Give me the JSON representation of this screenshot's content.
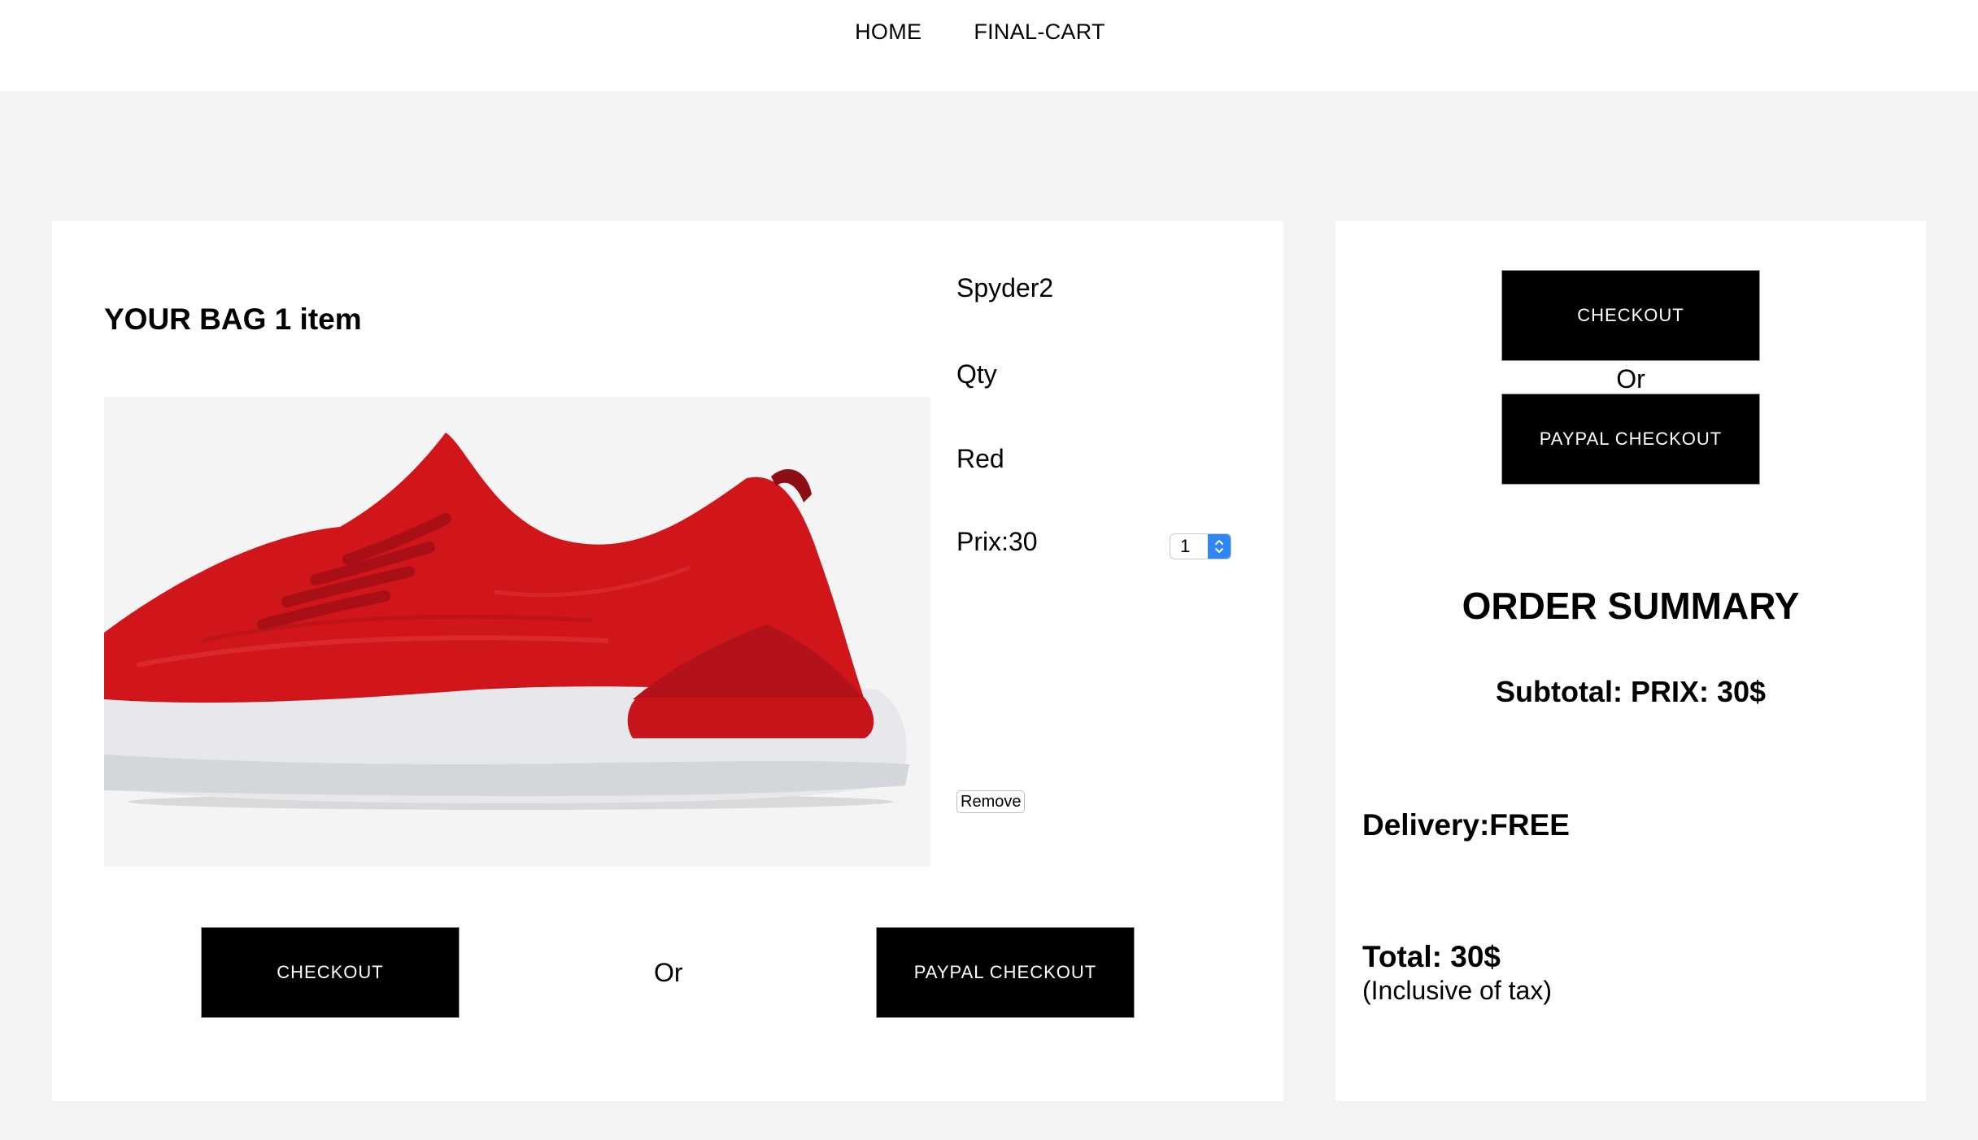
{
  "nav": {
    "items": [
      {
        "label": "HOME"
      },
      {
        "label": "FINAL-CART"
      }
    ]
  },
  "bag": {
    "title": "YOUR BAG 1 item",
    "item": {
      "name": "Spyder2",
      "qty_label": "Qty",
      "qty_value": "1",
      "color": "Red",
      "price": "Prix:30",
      "remove_label": "Remove"
    },
    "checkout_label": "CHECKOUT",
    "or_label": "Or",
    "paypal_label": "PAYPAL CHECKOUT"
  },
  "summary": {
    "checkout_label": "CHECKOUT",
    "or_label": "Or",
    "paypal_label": "PAYPAL CHECKOUT",
    "title": "ORDER SUMMARY",
    "subtotal": "Subtotal: PRIX: 30$",
    "delivery": "Delivery:FREE",
    "total": "Total: 30$",
    "tax_note": "(Inclusive of tax)"
  },
  "colors": {
    "page_bg": "#f3f3f3",
    "panel_bg": "#ffffff",
    "button_bg": "#000000",
    "stepper_accent": "#2f86f6",
    "product_red": "#d0161b"
  },
  "icons": {
    "qty_stepper": "up-down-chevron-icon"
  }
}
